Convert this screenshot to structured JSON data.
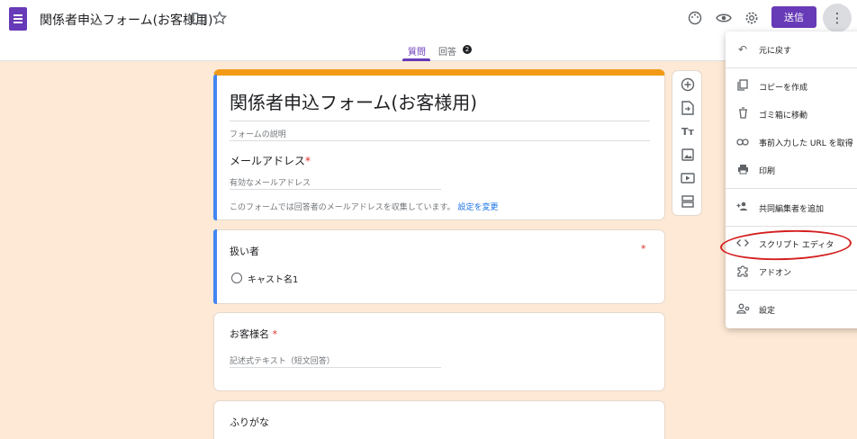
{
  "header": {
    "title": "関係者申込フォーム(お客様用)",
    "send_label": "送信",
    "tabs": [
      {
        "label": "質問",
        "active": true
      },
      {
        "label": "回答",
        "badge": "2"
      }
    ],
    "icons": [
      "folder-icon",
      "star-icon",
      "palette-icon",
      "preview-eye-icon",
      "settings-gear-icon",
      "more-vert-icon"
    ]
  },
  "form": {
    "title": "関係者申込フォーム(お客様用)",
    "description_placeholder": "フォームの説明",
    "email_label": "メールアドレス",
    "required_mark": "*",
    "email_placeholder": "有効なメールアドレス",
    "email_notice": "このフォームでは回答者のメールアドレスを収集しています。",
    "email_notice_link": "設定を変更",
    "questions": [
      {
        "title": "扱い者",
        "required": true,
        "options": [
          "キャスト名1"
        ]
      },
      {
        "title": "お客様名",
        "required": true,
        "placeholder": "記述式テキスト（短文回答）"
      },
      {
        "title": "ふりがな"
      }
    ]
  },
  "menu": {
    "items": [
      {
        "icon": "undo-icon",
        "label": "元に戻す"
      },
      {
        "icon": "copy-icon",
        "label": "コピーを作成"
      },
      {
        "icon": "trash-icon",
        "label": "ゴミ箱に移動"
      },
      {
        "icon": "link-icon",
        "label": "事前入力した URL を取得"
      },
      {
        "icon": "print-icon",
        "label": "印刷"
      },
      {
        "icon": "add-collaborator-icon",
        "label": "共同編集者を追加"
      },
      {
        "icon": "code-icon",
        "label": "スクリプト エディタ"
      },
      {
        "icon": "puzzle-icon",
        "label": "アドオン"
      },
      {
        "icon": "preferences-icon",
        "label": "設定"
      }
    ]
  },
  "colors": {
    "theme_purple": "#673ab7",
    "canvas_bg": "#fde9d5",
    "header_accent": "#f29a18",
    "focus_blue": "#4285f4",
    "annotation_red": "#d42020"
  }
}
